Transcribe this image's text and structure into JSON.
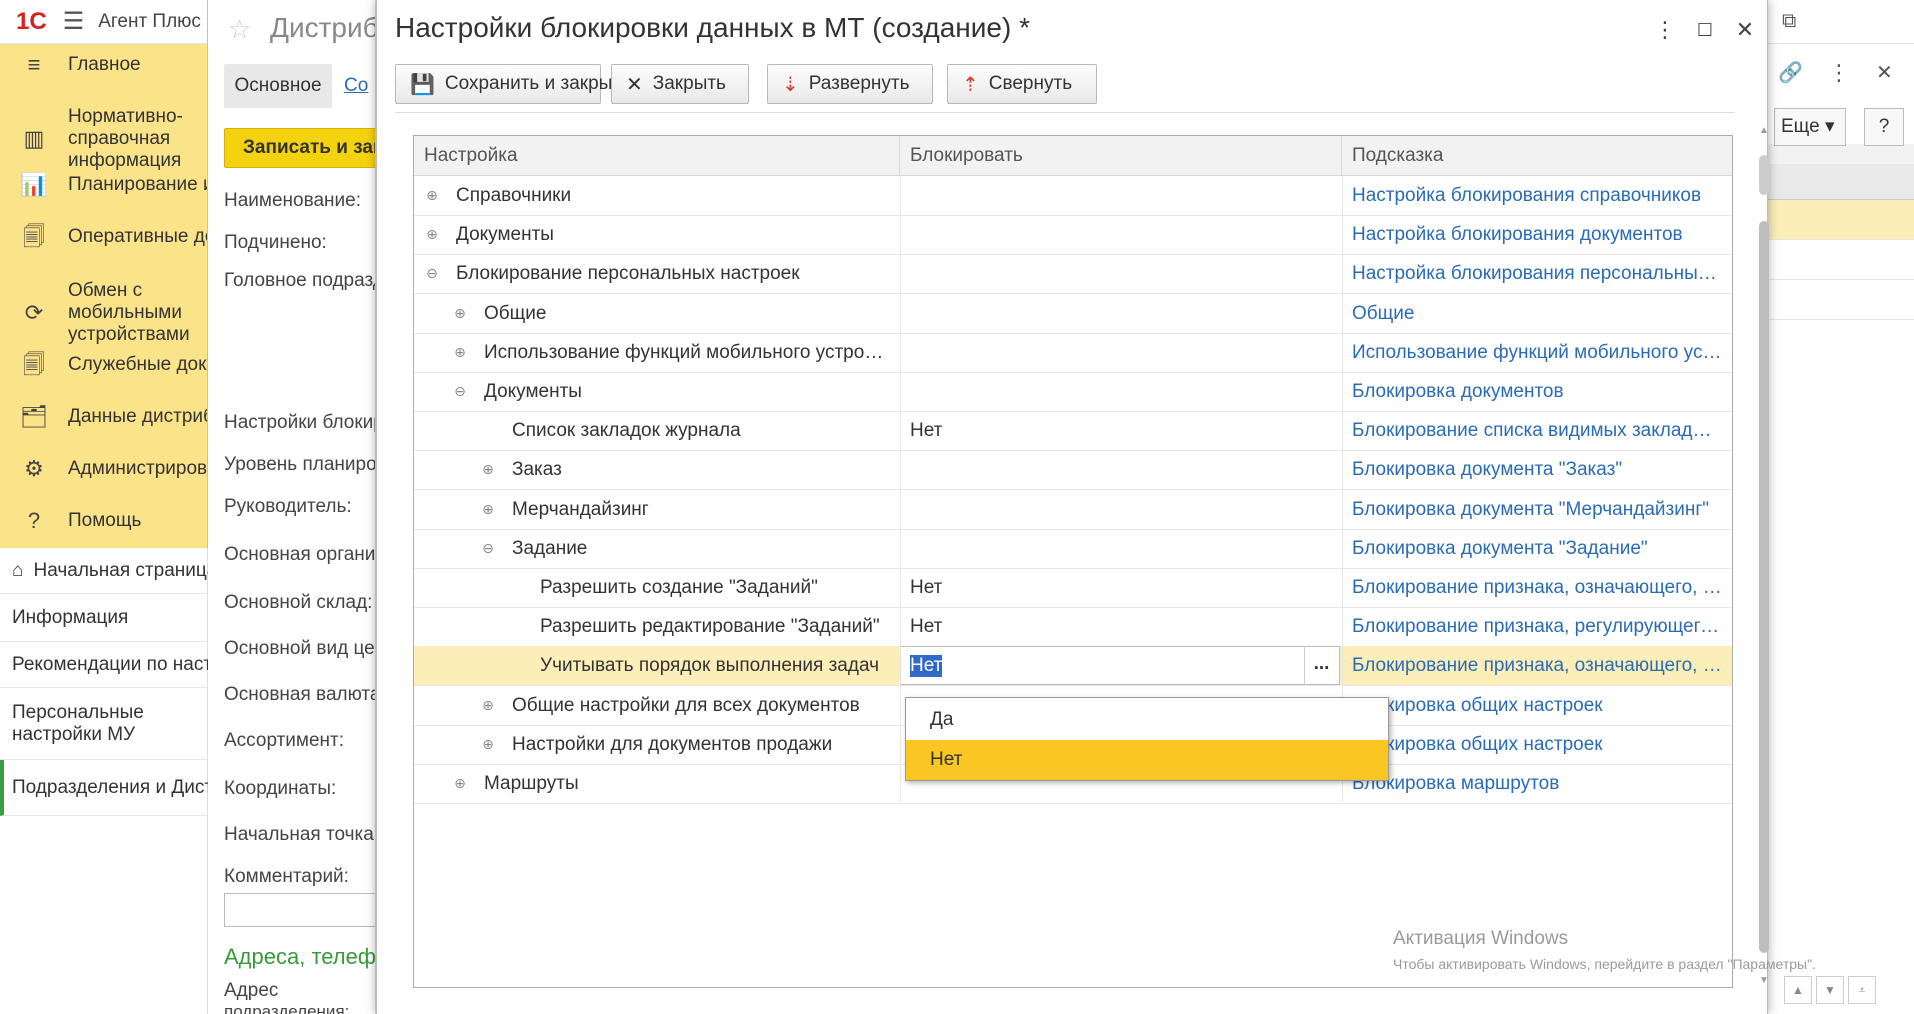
{
  "app": {
    "logo": "1С",
    "name": "Агент Плюс"
  },
  "sidebar": {
    "items": [
      {
        "icon": "≡",
        "label": "Главное"
      },
      {
        "icon": "▥",
        "label": "Нормативно-справочная информация"
      },
      {
        "icon": "📊",
        "label": "Планирование и"
      },
      {
        "icon": "🗐",
        "label": "Оперативные до"
      },
      {
        "icon": "⟳",
        "label": "Обмен с мобильными устройствами"
      },
      {
        "icon": "🗐",
        "label": "Служебные доку"
      },
      {
        "icon": "🗂",
        "label": "Данные дистриб"
      },
      {
        "icon": "⚙",
        "label": "Администрирова"
      },
      {
        "icon": "?",
        "label": "Помощь"
      }
    ]
  },
  "opened": {
    "items": [
      {
        "icon": "⌂",
        "label": "Начальная страница"
      },
      {
        "label": "Информация"
      },
      {
        "label": "Рекомендации по настройке"
      },
      {
        "label": "Персональные настройки МУ"
      },
      {
        "label": "Подразделения и Дистрибьюторы"
      }
    ]
  },
  "bgform": {
    "title": "Дистрибьютор",
    "tab_main": "Основное",
    "tab_other": "Со",
    "save_btn": "Записать и закрыть",
    "labels": [
      "Наименование:",
      "Подчинено:",
      "Головное подразделение:",
      "Настройки блокировки",
      "Уровень планирования",
      "Руководитель:",
      "Основная организация",
      "Основной склад:",
      "Основной вид цен",
      "Основная валюта",
      "Ассортимент:",
      "Координаты:",
      "Начальная точка",
      "Комментарий:"
    ],
    "address_header": "Адреса, телефоны",
    "address_label": "Адрес",
    "address_label2": "подразделения:"
  },
  "bgright": {
    "more": "Еще",
    "help": "?"
  },
  "modal": {
    "title": "Настройки блокировки данных в МТ (создание) *",
    "toolbar": {
      "save_close": "Сохранить и закрыть",
      "close": "Закрыть",
      "expand": "Развернуть",
      "collapse": "Свернуть"
    },
    "columns": {
      "name": "Настройка",
      "block": "Блокировать",
      "hint": "Подсказка"
    },
    "rows": [
      {
        "level": 0,
        "toggle": "⊕",
        "name": "Справочники",
        "value": "",
        "hint": "Настройка блокирования справочников"
      },
      {
        "level": 0,
        "toggle": "⊕",
        "name": "Документы",
        "value": "",
        "hint": "Настройка блокирования документов"
      },
      {
        "level": 0,
        "toggle": "⊖",
        "name": "Блокирование персональных настроек",
        "value": "",
        "hint": "Настройка блокирования персональных настроек"
      },
      {
        "level": 1,
        "toggle": "⊕",
        "name": "Общие",
        "value": "",
        "hint": "Общие"
      },
      {
        "level": 1,
        "toggle": "⊕",
        "name": "Использование функций мобильного устройства",
        "value": "",
        "hint": "Использование функций мобильного устройства"
      },
      {
        "level": 1,
        "toggle": "⊖",
        "name": "Документы",
        "value": "",
        "hint": "Блокировка документов"
      },
      {
        "level": 2,
        "toggle": "",
        "name": "Список закладок журнала",
        "value": "Нет",
        "hint": "Блокирование списка видимых закладок журнала"
      },
      {
        "level": 2,
        "toggle": "⊕",
        "name": "Заказ",
        "value": "",
        "hint": "Блокировка документа \"Заказ\""
      },
      {
        "level": 2,
        "toggle": "⊕",
        "name": "Мерчандайзинг",
        "value": "",
        "hint": "Блокировка документа \"Мерчандайзинг\""
      },
      {
        "level": 2,
        "toggle": "⊖",
        "name": "Задание",
        "value": "",
        "hint": "Блокировка документа \"Задание\""
      },
      {
        "level": 3,
        "toggle": "",
        "name": "Разрешить создание \"Заданий\"",
        "value": "Нет",
        "hint": "Блокирование признака, означающего, что агент может создавать"
      },
      {
        "level": 3,
        "toggle": "",
        "name": "Разрешить редактирование \"Заданий\"",
        "value": "Нет",
        "hint": "Блокирование признака, регулирующего редактирование"
      },
      {
        "level": 3,
        "toggle": "",
        "name": "Учитывать порядок выполнения задач",
        "value": "Нет",
        "hint": "Блокирование признака, означающего, что порядок",
        "selected": true
      },
      {
        "level": 2,
        "toggle": "⊕",
        "name": "Общие настройки для всех документов",
        "value": "",
        "hint": "Блокировка общих настроек"
      },
      {
        "level": 2,
        "toggle": "⊕",
        "name": "Настройки для документов продажи",
        "value": "",
        "hint": "Блокировка общих настроек"
      },
      {
        "level": 1,
        "toggle": "⊕",
        "name": "Маршруты",
        "value": "",
        "hint": "Блокировка маршрутов"
      }
    ],
    "dropdown": {
      "options": [
        "Да",
        "Нет"
      ],
      "selected": "Нет"
    },
    "ellipsis": "..."
  },
  "watermark": {
    "title": "Активация Windows",
    "text": "Чтобы активировать Windows, перейдите в раздел \"Параметры\"."
  }
}
